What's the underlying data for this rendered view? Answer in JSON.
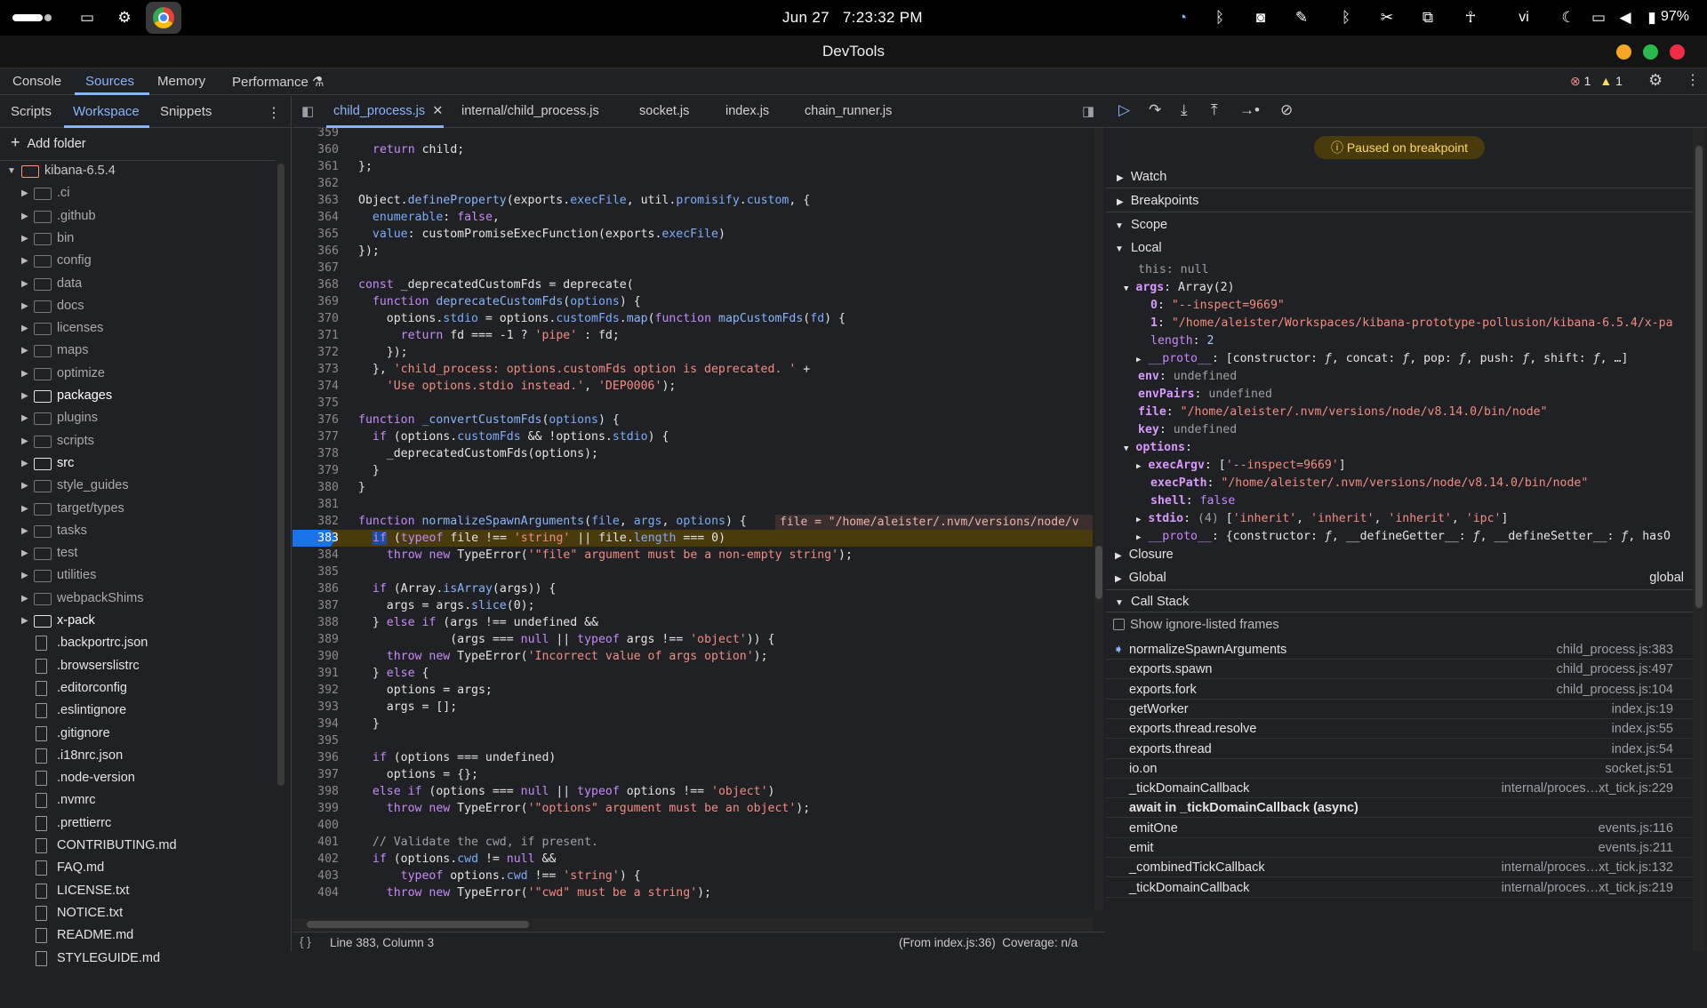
{
  "system_bar": {
    "date": "Jun 27",
    "time": "7:23:32 PM",
    "lang": "vi",
    "battery": "97%"
  },
  "window": {
    "title": "DevTools"
  },
  "main_tabs": [
    "Console",
    "Sources",
    "Memory",
    "Performance"
  ],
  "errors": {
    "errors": "1",
    "warnings": "1"
  },
  "navigator": {
    "tabs": [
      "Scripts",
      "Workspace",
      "Snippets"
    ],
    "add_folder": "Add folder",
    "root": "kibana-6.5.4",
    "folders": [
      ".ci",
      ".github",
      "bin",
      "config",
      "data",
      "docs",
      "licenses",
      "maps",
      "optimize",
      "packages",
      "plugins",
      "scripts",
      "src",
      "style_guides",
      "target/types",
      "tasks",
      "test",
      "utilities",
      "webpackShims",
      "x-pack"
    ],
    "files": [
      ".backportrc.json",
      ".browserslistrc",
      ".editorconfig",
      ".eslintignore",
      ".gitignore",
      ".i18nrc.json",
      ".node-version",
      ".nvmrc",
      ".prettierrc",
      "CONTRIBUTING.md",
      "FAQ.md",
      "LICENSE.txt",
      "NOTICE.txt",
      "README.md",
      "STYLEGUIDE.md"
    ]
  },
  "editor": {
    "tabs": [
      "child_process.js",
      "internal/child_process.js",
      "socket.js",
      "index.js",
      "chain_runner.js"
    ],
    "inline_value": "file = \"/home/aleister/.nvm/versions/node/v",
    "status_line": "Line 383, Column 3",
    "status_right": "(From index.js:36)  Coverage: n/a"
  },
  "debugger": {
    "paused": "Paused on breakpoint",
    "sections": {
      "watch": "Watch",
      "breakpoints": "Breakpoints",
      "scope": "Scope",
      "local": "Local",
      "closure": "Closure",
      "global": "Global",
      "global_value": "global",
      "call_stack": "Call Stack"
    },
    "show_ignore": "Show ignore-listed frames",
    "call_stack": [
      {
        "name": "normalizeSpawnArguments",
        "loc": "child_process.js:383"
      },
      {
        "name": "exports.spawn",
        "loc": "child_process.js:497"
      },
      {
        "name": "exports.fork",
        "loc": "child_process.js:104"
      },
      {
        "name": "getWorker",
        "loc": "index.js:19"
      },
      {
        "name": "exports.thread.resolve",
        "loc": "index.js:55"
      },
      {
        "name": "exports.thread",
        "loc": "index.js:54"
      },
      {
        "name": "io.on",
        "loc": "socket.js:51"
      },
      {
        "name": "_tickDomainCallback",
        "loc": "internal/proces…xt_tick.js:229"
      },
      {
        "name": "await in _tickDomainCallback (async)",
        "loc": ""
      },
      {
        "name": "emitOne",
        "loc": "events.js:116"
      },
      {
        "name": "emit",
        "loc": "events.js:211"
      },
      {
        "name": "_combinedTickCallback",
        "loc": "internal/proces…xt_tick.js:132"
      },
      {
        "name": "_tickDomainCallback",
        "loc": "internal/proces…xt_tick.js:219"
      }
    ]
  },
  "colors": {
    "accent": "#8ab4f8",
    "breakpoint": "#1a73e8",
    "paused_bg": "#4a3b0d"
  }
}
